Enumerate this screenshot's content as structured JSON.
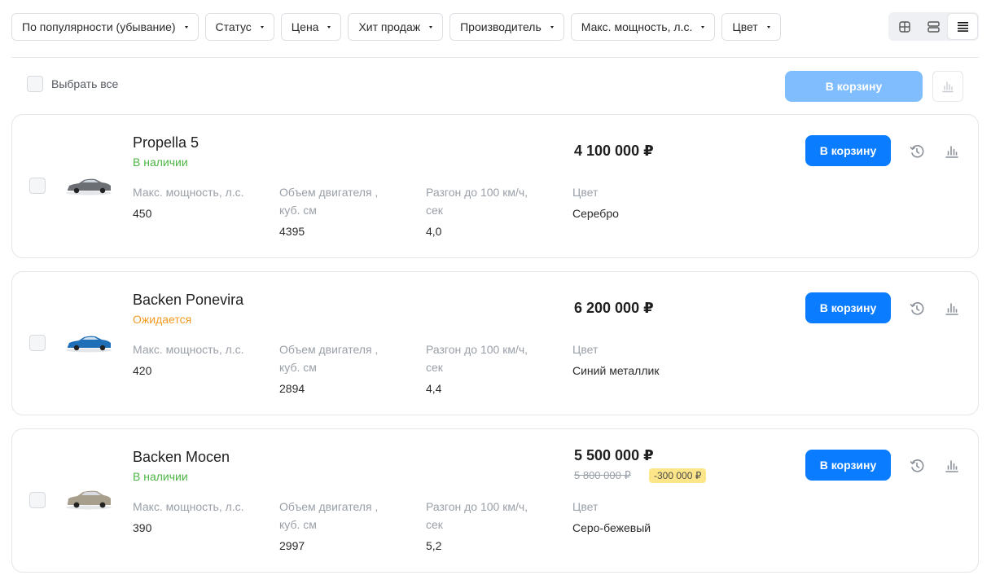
{
  "filters": [
    {
      "label": "По популярности (убывание)"
    },
    {
      "label": "Статус"
    },
    {
      "label": "Цена"
    },
    {
      "label": "Хит продаж"
    },
    {
      "label": "Производитель"
    },
    {
      "label": "Макс. мощность, л.с."
    },
    {
      "label": "Цвет"
    }
  ],
  "view_switch": {
    "options": [
      "grid-view-icon",
      "rows-view-icon",
      "list-view-icon"
    ],
    "selected": "list-view-icon"
  },
  "select_all": {
    "label": "Выбрать все"
  },
  "bulk": {
    "cart_label": "В корзину"
  },
  "colors": {
    "accent": "#0a7cff",
    "accent_disabled": "#80bdfe",
    "in_stock": "#4bb543",
    "expected": "#f59a23"
  },
  "spec_labels": {
    "power": "Макс. мощность, л.с.",
    "engine_1": "Объем двигателя ,",
    "engine_2": "куб. см",
    "accel_1": "Разгон до 100 км/ч,",
    "accel_2": "сек",
    "color": "Цвет"
  },
  "products": [
    {
      "name": "Propella 5",
      "status": "В наличии",
      "power": "450",
      "engine": "4395",
      "accel": "4,0",
      "color": "Серебро",
      "price": "4 100 000 ₽",
      "old_price": "",
      "discount": "",
      "cart_label": "В корзину",
      "car_color": "#6b6e73"
    },
    {
      "name": "Backen Ponevira",
      "status": "Ожидается",
      "power": "420",
      "engine": "2894",
      "accel": "4,4",
      "color": "Синий металлик",
      "price": "6 200 000 ₽",
      "old_price": "",
      "discount": "",
      "cart_label": "В корзину",
      "car_color": "#1f6fb8"
    },
    {
      "name": "Backen Mocen",
      "status": "В наличии",
      "power": "390",
      "engine": "2997",
      "accel": "5,2",
      "color": "Серо-бежевый",
      "price": "5 500 000 ₽",
      "old_price": "5 800 000 ₽",
      "discount": "-300 000 ₽",
      "cart_label": "В корзину",
      "car_color": "#a89e8c"
    }
  ]
}
